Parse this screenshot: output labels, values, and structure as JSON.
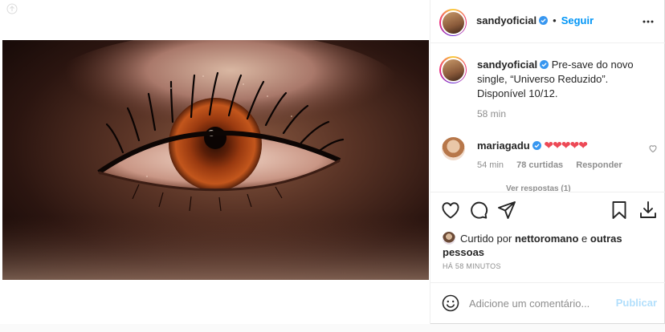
{
  "post": {
    "author": "sandyoficial",
    "follow_label": "Seguir",
    "separator": "•",
    "caption": "Pre-save do novo single, “Universo Reduzido”. Disponível 10/12.",
    "caption_time": "58 min",
    "likes_prefix": "Curtido por",
    "liked_by": "nettoromano",
    "likes_connector": "e",
    "likes_others": "outras pessoas",
    "time_ago": "HÁ 58 MINUTOS"
  },
  "comment": {
    "author": "mariagadu",
    "text": "❤❤❤❤❤",
    "time": "54 min",
    "likes": "78 curtidas",
    "reply_label": "Responder"
  },
  "replies_label": "Ver respostas (1)",
  "add_comment": {
    "placeholder": "Adicione um comentário...",
    "publish_label": "Publicar"
  },
  "colors": {
    "accent": "#0095f6",
    "heart": "#ed4956",
    "publish_disabled": "#b2dffc",
    "muted": "#8e8e8e"
  },
  "icons": [
    "user-tag-icon",
    "verified-icon",
    "more-icon",
    "heart-icon",
    "comment-icon",
    "share-icon",
    "bookmark-icon",
    "download-icon",
    "emoji-icon"
  ]
}
